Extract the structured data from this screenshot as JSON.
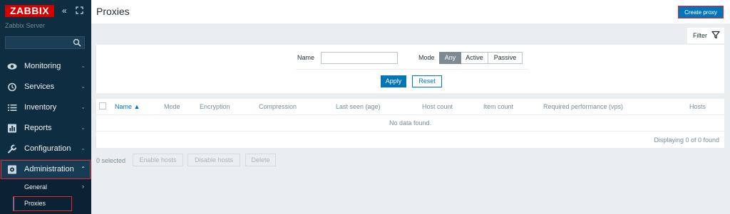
{
  "sidebar": {
    "logo": "ZABBIX",
    "collapse_icon": "double-chevron-left-icon",
    "kiosk_icon": "kiosk-mode-icon",
    "server_name": "Zabbix Server",
    "search": {
      "value": "",
      "placeholder": ""
    },
    "menu": [
      {
        "label": "Monitoring",
        "icon": "eye-icon"
      },
      {
        "label": "Services",
        "icon": "clock-icon"
      },
      {
        "label": "Inventory",
        "icon": "list-icon"
      },
      {
        "label": "Reports",
        "icon": "bar-chart-icon"
      },
      {
        "label": "Configuration",
        "icon": "wrench-icon"
      },
      {
        "label": "Administration",
        "icon": "gear-icon"
      }
    ],
    "submenu": [
      {
        "label": "General"
      },
      {
        "label": "Proxies"
      }
    ]
  },
  "header": {
    "title": "Proxies",
    "create_button": "Create proxy"
  },
  "filter": {
    "tab_label": "Filter",
    "name_label": "Name",
    "name_value": "",
    "mode_label": "Mode",
    "mode_options": [
      "Any",
      "Active",
      "Passive"
    ],
    "mode_selected": "Any",
    "apply": "Apply",
    "reset": "Reset"
  },
  "table": {
    "columns": [
      "Name",
      "Mode",
      "Encryption",
      "Compression",
      "Last seen (age)",
      "Host count",
      "Item count",
      "Required performance (vps)",
      "Hosts"
    ],
    "sort_indicator": "▲",
    "empty_message": "No data found.",
    "footer": "Displaying 0 of 0 found"
  },
  "mass_actions": {
    "selected": "0 selected",
    "buttons": [
      "Enable hosts",
      "Disable hosts",
      "Delete"
    ]
  },
  "colors": {
    "sidebar_bg": "#0e2d40",
    "accent": "#0275b8",
    "logo_red": "#d40000",
    "highlight": "#e8262b"
  }
}
